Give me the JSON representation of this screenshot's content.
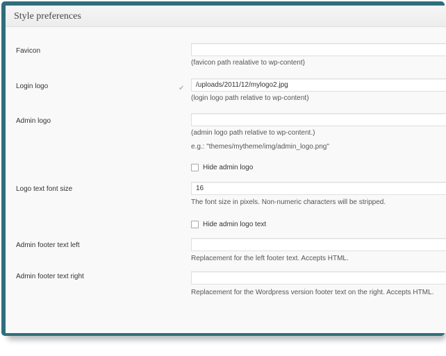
{
  "section": {
    "title": "Style preferences"
  },
  "fields": {
    "favicon": {
      "label": "Favicon",
      "value": "",
      "description": "(favicon path realative to wp-content)"
    },
    "login_logo": {
      "label": "Login logo",
      "value": "/uploads/2011/12/mylogo2.jpg",
      "description": "(login logo path relative to wp-content)"
    },
    "admin_logo": {
      "label": "Admin logo",
      "value": "",
      "description": "(admin logo path relative to wp-content.)",
      "example": "e.g.: \"themes/mytheme/img/admin_logo.png\"",
      "hide_label": "Hide admin logo",
      "hide_checked": false
    },
    "logo_font_size": {
      "label": "Logo text font size",
      "value": "16",
      "description": "The font size in pixels. Non-numeric characters will be stripped.",
      "hide_label": "Hide admin logo text",
      "hide_checked": false
    },
    "footer_left": {
      "label": "Admin footer text left",
      "value": "",
      "description": "Replacement for the left footer text. Accepts HTML."
    },
    "footer_right": {
      "label": "Admin footer text right",
      "value": "",
      "description": "Replacement for the Wordpress version footer text on the right. Accepts HTML."
    }
  },
  "icons": {
    "validation": "checkmark-icon"
  },
  "colors": {
    "frame": "#2f6e7a",
    "panel_bg": "#f9f9f9"
  }
}
